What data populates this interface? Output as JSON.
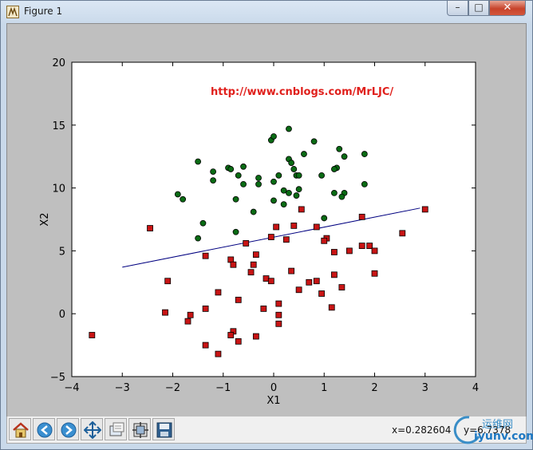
{
  "window": {
    "title": "Figure 1",
    "controls": {
      "minimize": "–",
      "maximize": "□",
      "close": "✕"
    }
  },
  "toolbar": {
    "buttons": [
      {
        "name": "home-button",
        "icon": "home-icon"
      },
      {
        "name": "back-button",
        "icon": "back-arrow-icon"
      },
      {
        "name": "forward-button",
        "icon": "forward-arrow-icon"
      },
      {
        "name": "pan-button",
        "icon": "move-arrows-icon"
      },
      {
        "name": "zoom-button",
        "icon": "zoom-rect-icon"
      },
      {
        "name": "subplots-button",
        "icon": "subplots-config-icon"
      },
      {
        "name": "save-button",
        "icon": "floppy-disk-icon"
      }
    ],
    "x_readout": "x=0.282604",
    "y_readout": "y=6.7378"
  },
  "watermark": {
    "top": "运维网",
    "bottom": "iyunv.com"
  },
  "chart_data": {
    "type": "scatter",
    "title": "",
    "xlabel": "X1",
    "ylabel": "X2",
    "xlim": [
      -4,
      4
    ],
    "ylim": [
      -5,
      20
    ],
    "xticks": [
      -4,
      -3,
      -2,
      -1,
      0,
      1,
      2,
      3,
      4
    ],
    "yticks": [
      -5,
      0,
      5,
      10,
      15,
      20
    ],
    "grid": false,
    "annotation": "http://www.cnblogs.com/MrLJC/",
    "colors": {
      "class1": "#0a6b14",
      "class0": "#c81414",
      "line": "#000080",
      "annotation": "#e0201c"
    },
    "series": [
      {
        "marker": "circle",
        "color": "#0a6b14",
        "points": [
          [
            0.3,
            14.7
          ],
          [
            -0.05,
            13.8
          ],
          [
            0,
            14.1
          ],
          [
            0.8,
            13.7
          ],
          [
            1.3,
            13.1
          ],
          [
            1.8,
            12.7
          ],
          [
            0.6,
            12.7
          ],
          [
            0.3,
            12.3
          ],
          [
            -1.5,
            12.1
          ],
          [
            -0.6,
            11.7
          ],
          [
            -0.9,
            11.6
          ],
          [
            -0.85,
            11.5
          ],
          [
            -1.2,
            11.3
          ],
          [
            0.4,
            11.5
          ],
          [
            0.45,
            11.0
          ],
          [
            0.5,
            11.0
          ],
          [
            0.95,
            11.0
          ],
          [
            1.4,
            12.5
          ],
          [
            1.25,
            11.6
          ],
          [
            1.2,
            11.5
          ],
          [
            -0.7,
            11.0
          ],
          [
            0.1,
            11.0
          ],
          [
            0.35,
            12.0
          ],
          [
            -1.2,
            10.6
          ],
          [
            -0.3,
            10.8
          ],
          [
            -0.3,
            10.3
          ],
          [
            -0.6,
            10.3
          ],
          [
            0,
            10.5
          ],
          [
            1.8,
            10.3
          ],
          [
            0.5,
            9.9
          ],
          [
            0.2,
            9.8
          ],
          [
            0.3,
            9.6
          ],
          [
            0.45,
            9.4
          ],
          [
            1.2,
            9.6
          ],
          [
            1.4,
            9.6
          ],
          [
            -1.9,
            9.5
          ],
          [
            -1.8,
            9.1
          ],
          [
            -0.75,
            9.1
          ],
          [
            0,
            9.0
          ],
          [
            1.35,
            9.3
          ],
          [
            0.2,
            8.7
          ],
          [
            -0.4,
            8.1
          ],
          [
            1.0,
            7.6
          ],
          [
            -1.4,
            7.2
          ],
          [
            -0.75,
            6.5
          ],
          [
            -1.5,
            6.0
          ]
        ]
      },
      {
        "marker": "square",
        "color": "#c81414",
        "points": [
          [
            3.0,
            8.3
          ],
          [
            0.55,
            8.3
          ],
          [
            1.75,
            7.7
          ],
          [
            2.55,
            6.4
          ],
          [
            0.05,
            6.9
          ],
          [
            0.4,
            7.0
          ],
          [
            0.85,
            6.9
          ],
          [
            -2.45,
            6.8
          ],
          [
            1.05,
            6.0
          ],
          [
            1.0,
            5.8
          ],
          [
            0.25,
            5.9
          ],
          [
            -0.55,
            5.6
          ],
          [
            -0.05,
            6.1
          ],
          [
            1.75,
            5.4
          ],
          [
            1.9,
            5.4
          ],
          [
            2.0,
            5.0
          ],
          [
            1.2,
            4.9
          ],
          [
            1.5,
            5.0
          ],
          [
            -1.35,
            4.6
          ],
          [
            -0.35,
            4.7
          ],
          [
            -0.85,
            4.3
          ],
          [
            -0.8,
            3.9
          ],
          [
            -0.4,
            3.9
          ],
          [
            0.35,
            3.4
          ],
          [
            -0.45,
            3.3
          ],
          [
            1.2,
            3.1
          ],
          [
            2.0,
            3.2
          ],
          [
            -0.15,
            2.8
          ],
          [
            -0.05,
            2.6
          ],
          [
            0.7,
            2.5
          ],
          [
            0.85,
            2.6
          ],
          [
            1.35,
            2.1
          ],
          [
            -2.1,
            2.6
          ],
          [
            0.5,
            1.9
          ],
          [
            0.95,
            1.6
          ],
          [
            -1.1,
            1.7
          ],
          [
            -0.7,
            1.1
          ],
          [
            0.1,
            0.8
          ],
          [
            -0.2,
            0.4
          ],
          [
            1.15,
            0.5
          ],
          [
            -1.35,
            0.4
          ],
          [
            -2.15,
            0.1
          ],
          [
            -1.65,
            -0.1
          ],
          [
            0.1,
            -0.1
          ],
          [
            -1.7,
            -0.6
          ],
          [
            0.1,
            -0.8
          ],
          [
            -0.8,
            -1.4
          ],
          [
            -0.85,
            -1.7
          ],
          [
            -0.35,
            -1.8
          ],
          [
            -3.6,
            -1.7
          ],
          [
            -0.7,
            -2.2
          ],
          [
            -1.35,
            -2.5
          ],
          [
            -1.1,
            -3.2
          ]
        ]
      }
    ],
    "line": {
      "x": [
        -3.0,
        2.9
      ],
      "y": [
        3.7,
        8.4
      ]
    }
  }
}
